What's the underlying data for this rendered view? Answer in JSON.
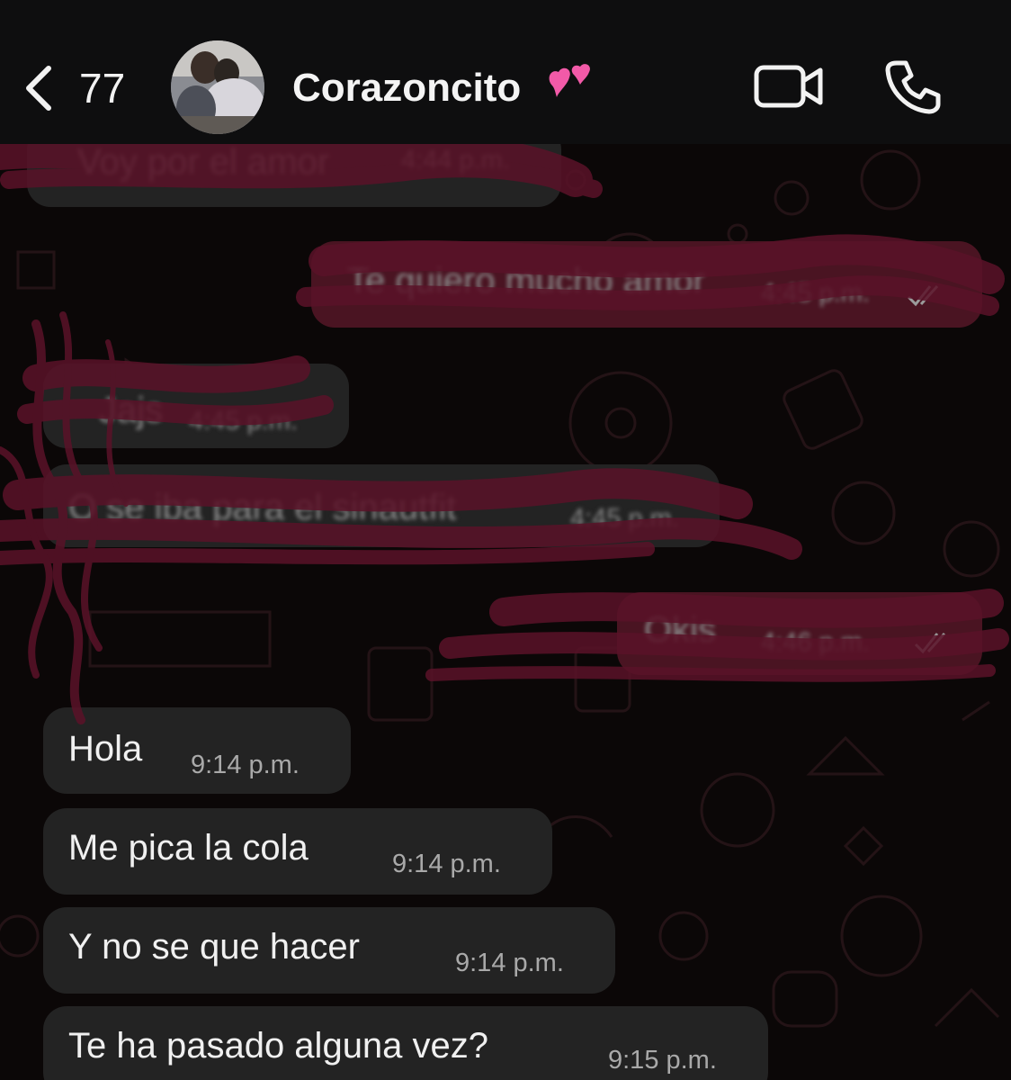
{
  "header": {
    "back_count": "77",
    "contact_name": "Corazoncito",
    "name_emoji": "💕",
    "icons": {
      "back": "chevron-left-icon",
      "video": "video-camera-icon",
      "call": "phone-icon"
    }
  },
  "colors": {
    "header_bg": "#0e0e0f",
    "chat_bg": "#0b0707",
    "incoming_bubble": "#232323",
    "outgoing_bubble": "#4a1422",
    "scribble": "#5a1228"
  },
  "messages": [
    {
      "direction": "incoming",
      "text": "Voy por el amor",
      "time": "4:44 p.m.",
      "redacted": true
    },
    {
      "direction": "outgoing",
      "text": "Te quiero mucho amor",
      "time": "4:45 p.m.",
      "redacted": true,
      "status": "read-ticks-icon"
    },
    {
      "direction": "incoming",
      "text": "Jajs",
      "time": "4:45 p.m.",
      "redacted": true
    },
    {
      "direction": "incoming",
      "text": "O se iba para el sinautfit",
      "time": "4:45 p.m.",
      "redacted": true
    },
    {
      "direction": "outgoing",
      "text": "Okis",
      "time": "4:46 p.m.",
      "redacted": true,
      "status": "read-ticks-icon"
    },
    {
      "direction": "incoming",
      "text": "Hola",
      "time": "9:14 p.m.",
      "redacted": false
    },
    {
      "direction": "incoming",
      "text": "Me pica la cola",
      "time": "9:14 p.m.",
      "redacted": false
    },
    {
      "direction": "incoming",
      "text": "Y no se que hacer",
      "time": "9:14 p.m.",
      "redacted": false
    },
    {
      "direction": "incoming",
      "text": "Te ha pasado alguna vez?",
      "time": "9:15 p.m.",
      "redacted": false
    }
  ]
}
